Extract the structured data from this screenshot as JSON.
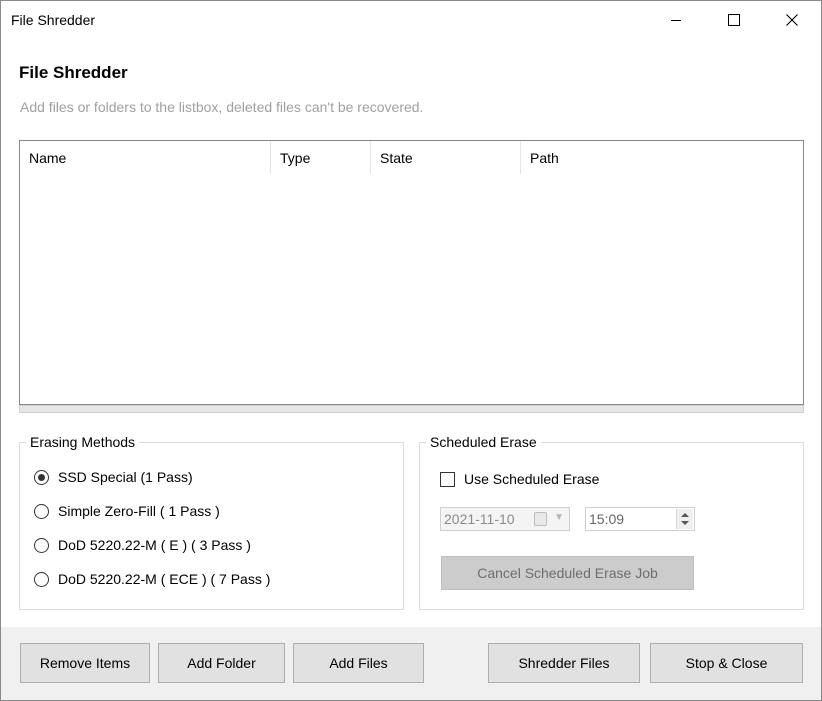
{
  "window": {
    "title": "File Shredder"
  },
  "main": {
    "heading": "File Shredder",
    "subtitle": "Add files or folders to the listbox, deleted files can't be recovered."
  },
  "listbox": {
    "columns": [
      "Name",
      "Type",
      "State",
      "Path"
    ],
    "rows": []
  },
  "erasing_methods": {
    "title": "Erasing Methods",
    "options": [
      {
        "label": "SSD Special (1 Pass)",
        "checked": true
      },
      {
        "label": "Simple Zero-Fill ( 1 Pass )",
        "checked": false
      },
      {
        "label": "DoD 5220.22-M ( E ) ( 3 Pass )",
        "checked": false
      },
      {
        "label": "DoD 5220.22-M ( ECE ) ( 7 Pass )",
        "checked": false
      }
    ]
  },
  "scheduled_erase": {
    "title": "Scheduled Erase",
    "checkbox_label": "Use Scheduled Erase",
    "checked": false,
    "date": "2021-11-10",
    "time": "15:09",
    "cancel_label": "Cancel Scheduled Erase Job"
  },
  "footer": {
    "remove_label": "Remove Items",
    "add_folder_label": "Add Folder",
    "add_files_label": "Add Files",
    "shredder_label": "Shredder Files",
    "stop_close_label": "Stop & Close"
  },
  "icons": {
    "minimize": "minimize-icon",
    "maximize": "maximize-icon",
    "close": "close-icon",
    "calendar": "calendar-icon",
    "chevron": "chevron-down-icon"
  }
}
